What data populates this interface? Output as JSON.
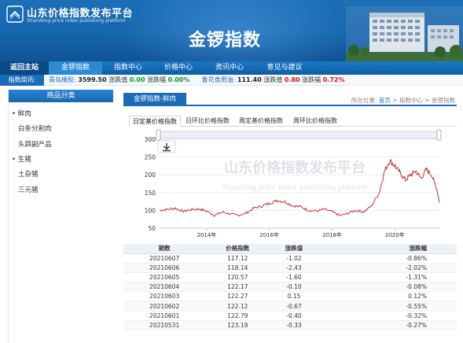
{
  "header": {
    "logo_cn": "山东价格指数发布平台",
    "logo_en": "Shandong price index publishing platform",
    "page_title": "金锣指数"
  },
  "nav": {
    "items": [
      "返回主站",
      "金锣指数",
      "指数中心",
      "价格中心",
      "资讯中心",
      "意见与建议"
    ]
  },
  "ticker": {
    "label": "指数简讯:",
    "item1": {
      "name": "青岛橡胶:",
      "value": "3599.50",
      "chg_label": "涨跌值",
      "chg": "0.00",
      "pct_label": "涨跌幅",
      "pct": "0.00%"
    },
    "item2": {
      "name": "鲁花食用油:",
      "value": "111.40",
      "chg_label": "涨跌值",
      "chg": "0.80",
      "pct_label": "涨跌幅",
      "pct": "0.72%"
    }
  },
  "sidebar": {
    "title": "商品分类",
    "items": [
      "鲜肉",
      "白条分割肉",
      "头蹄副产品",
      "生猪",
      "土杂猪",
      "三元猪"
    ]
  },
  "main": {
    "tab": "金锣指数-鲜肉",
    "breadcrumb_prefix": "所在位置:",
    "breadcrumb_home": "首页",
    "breadcrumb_sep1": ">",
    "breadcrumb_center": "指数中心",
    "breadcrumb_sep2": ">",
    "breadcrumb_current": "金锣指数",
    "subtabs": [
      "日定基价格指数",
      "日环比价格指数",
      "周定基价格指数",
      "周环比价格指数"
    ]
  },
  "chart_data": {
    "type": "line",
    "title": "",
    "xlabel": "",
    "ylabel": "",
    "ylim": [
      50,
      300
    ],
    "yticks": [
      50,
      100,
      150,
      200,
      250,
      300
    ],
    "xtick_labels": [
      "2014年",
      "2016年",
      "2018年",
      "2020年"
    ],
    "line_color": "#c81e1e",
    "watermark_cn": "山东价格指数发布平台",
    "watermark_en": "Shandong price index publishing platform",
    "series": [
      {
        "x": [
          "2012-07",
          "2012-10",
          "2013-01",
          "2013-04",
          "2013-07",
          "2013-10",
          "2014-01",
          "2014-04",
          "2014-07",
          "2014-10",
          "2015-01",
          "2015-04",
          "2015-07",
          "2015-10",
          "2016-01",
          "2016-04",
          "2016-07",
          "2016-10",
          "2017-01",
          "2017-04",
          "2017-07",
          "2017-10",
          "2018-01",
          "2018-04",
          "2018-07",
          "2018-10",
          "2019-01",
          "2019-04",
          "2019-07",
          "2019-09",
          "2019-11",
          "2020-01",
          "2020-03",
          "2020-05",
          "2020-07",
          "2020-09",
          "2020-11",
          "2021-01",
          "2021-03",
          "2021-05",
          "2021-06"
        ],
        "values": [
          100,
          103,
          106,
          97,
          102,
          104,
          98,
          86,
          95,
          90,
          86,
          92,
          106,
          112,
          120,
          128,
          124,
          113,
          110,
          100,
          98,
          103,
          96,
          85,
          92,
          100,
          96,
          112,
          150,
          210,
          240,
          225,
          205,
          185,
          200,
          210,
          190,
          215,
          200,
          160,
          122
        ]
      }
    ]
  },
  "table": {
    "headers": [
      "期数",
      "价格指数",
      "涨跌值",
      "涨跌幅"
    ],
    "rows": [
      [
        "20210607",
        "117.12",
        "-1.02",
        "-0.86%"
      ],
      [
        "20210606",
        "118.14",
        "-2.43",
        "-2.02%"
      ],
      [
        "20210605",
        "120.57",
        "-1.60",
        "-1.31%"
      ],
      [
        "20210604",
        "122.17",
        "-0.10",
        "-0.08%"
      ],
      [
        "20210603",
        "122.27",
        "0.15",
        "0.12%"
      ],
      [
        "20210602",
        "122.12",
        "-0.67",
        "-0.55%"
      ],
      [
        "20210601",
        "122.79",
        "-0.40",
        "-0.32%"
      ],
      [
        "20210531",
        "123.19",
        "-0.33",
        "-0.27%"
      ]
    ]
  }
}
